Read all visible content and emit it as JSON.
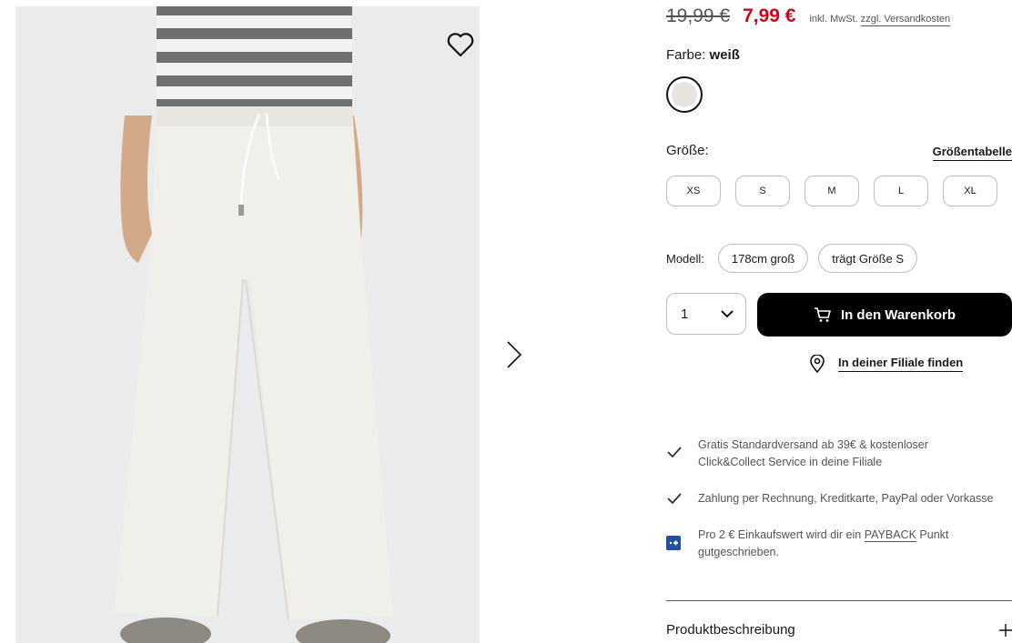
{
  "product": {
    "old_price": "19,99 €",
    "new_price": "7,99 €",
    "tax_note": "inkl. MwSt.",
    "shipping_link": "zzgl. Versandkosten",
    "color_label": "Farbe:",
    "color_value": "weiß",
    "swatch_color": "#e7e4df",
    "size_label": "Größe:",
    "size_chart_link": "Größentabelle",
    "sizes": [
      "XS",
      "S",
      "M",
      "L",
      "XL"
    ],
    "model_label": "Modell:",
    "model_height": "178cm groß",
    "model_size": "trägt Größe S",
    "quantity": "1",
    "add_to_cart": "In den Warenkorb",
    "find_in_store": "In deiner Filiale finden"
  },
  "benefits": {
    "shipping": "Gratis Standardversand ab 39€ & kostenloser Click&Collect Service in deine Filiale",
    "payment": "Zahlung per Rechnung, Kreditkarte, PayPal oder Vorkasse",
    "payback_prefix": "Pro 2 € Einkaufswert wird dir ein",
    "payback_link": "PAYBACK",
    "payback_suffix": "Punkt gutgeschrieben."
  },
  "accordion": {
    "description": "Produktbeschreibung"
  },
  "colors": {
    "price_red": "#d0021b",
    "button_black": "#000000",
    "payback_blue": "#1e4fa3",
    "image_bg": "#ebebeb"
  },
  "icons": [
    "heart-icon",
    "chevron-right-icon",
    "chevron-down-icon",
    "cart-icon",
    "location-pin-icon",
    "checkmark-icon",
    "payback-icon",
    "plus-icon"
  ]
}
